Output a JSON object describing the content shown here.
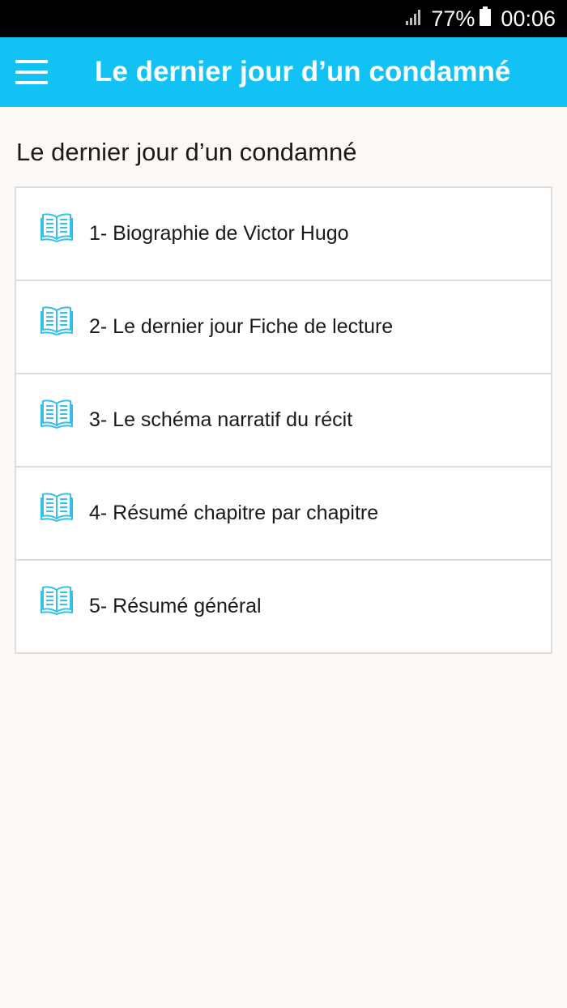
{
  "status_bar": {
    "battery_percent": "77%",
    "time": "00:06",
    "signal_icon": "signal-icon",
    "battery_icon": "battery-icon"
  },
  "app_bar": {
    "title": "Le dernier jour d’un condamné",
    "menu_icon": "hamburger-menu-icon"
  },
  "page": {
    "heading": "Le dernier jour d’un condamné"
  },
  "chapters": [
    {
      "label": "1- Biographie de Victor Hugo",
      "icon": "open-book-icon"
    },
    {
      "label": "2- Le dernier jour Fiche de lecture",
      "icon": "open-book-icon"
    },
    {
      "label": "3- Le schéma narratif du récit",
      "icon": "open-book-icon"
    },
    {
      "label": "4- Résumé chapitre par chapitre",
      "icon": "open-book-icon"
    },
    {
      "label": "5- Résumé général",
      "icon": "open-book-icon"
    }
  ],
  "colors": {
    "app_bar": "#12c2f4",
    "icon": "#35c0ea",
    "background": "#fdf9f7"
  }
}
